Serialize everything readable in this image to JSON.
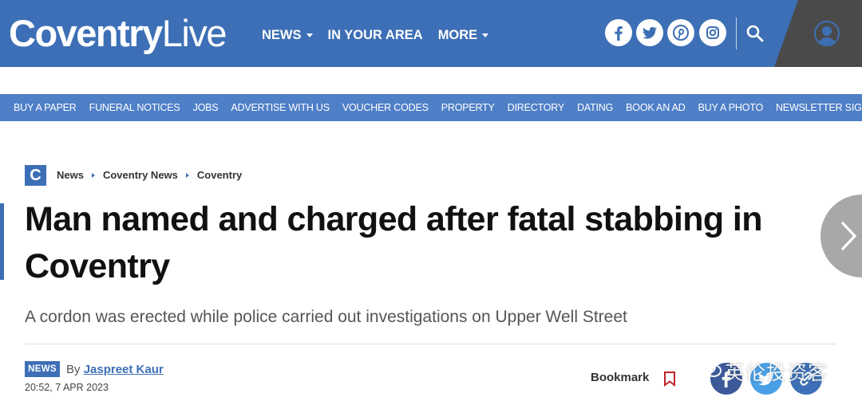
{
  "header": {
    "logo_bold": "Coventry",
    "logo_light": "Live",
    "nav": [
      {
        "label": "NEWS",
        "dropdown": true
      },
      {
        "label": "IN YOUR AREA",
        "dropdown": false
      },
      {
        "label": "MORE",
        "dropdown": true
      }
    ],
    "social_icons": [
      "facebook-icon",
      "twitter-icon",
      "pinterest-icon",
      "instagram-icon"
    ],
    "colors": {
      "brand": "#3d6fb6",
      "subnav": "#4f7fc7",
      "account": "#4a4a4a"
    }
  },
  "subnav": [
    "BUY A PAPER",
    "FUNERAL NOTICES",
    "JOBS",
    "ADVERTISE WITH US",
    "VOUCHER CODES",
    "PROPERTY",
    "DIRECTORY",
    "DATING",
    "BOOK AN AD",
    "BUY A PHOTO",
    "NEWSLETTER SIGNUP"
  ],
  "breadcrumb": {
    "badge": "C",
    "items": [
      "News",
      "Coventry News",
      "Coventry"
    ]
  },
  "article": {
    "headline": "Man named and charged after fatal stabbing in Coventry",
    "standfirst": "A cordon was erected while police carried out investigations on Upper Well Street",
    "tag": "NEWS",
    "by": "By",
    "author": "Jaspreet Kaur",
    "date": "20:52, 7 APR 2023",
    "bookmark_label": "Bookmark"
  },
  "share_icons": [
    "facebook-share-icon",
    "twitter-share-icon",
    "link-share-icon"
  ],
  "watermark": "英伦投资客"
}
